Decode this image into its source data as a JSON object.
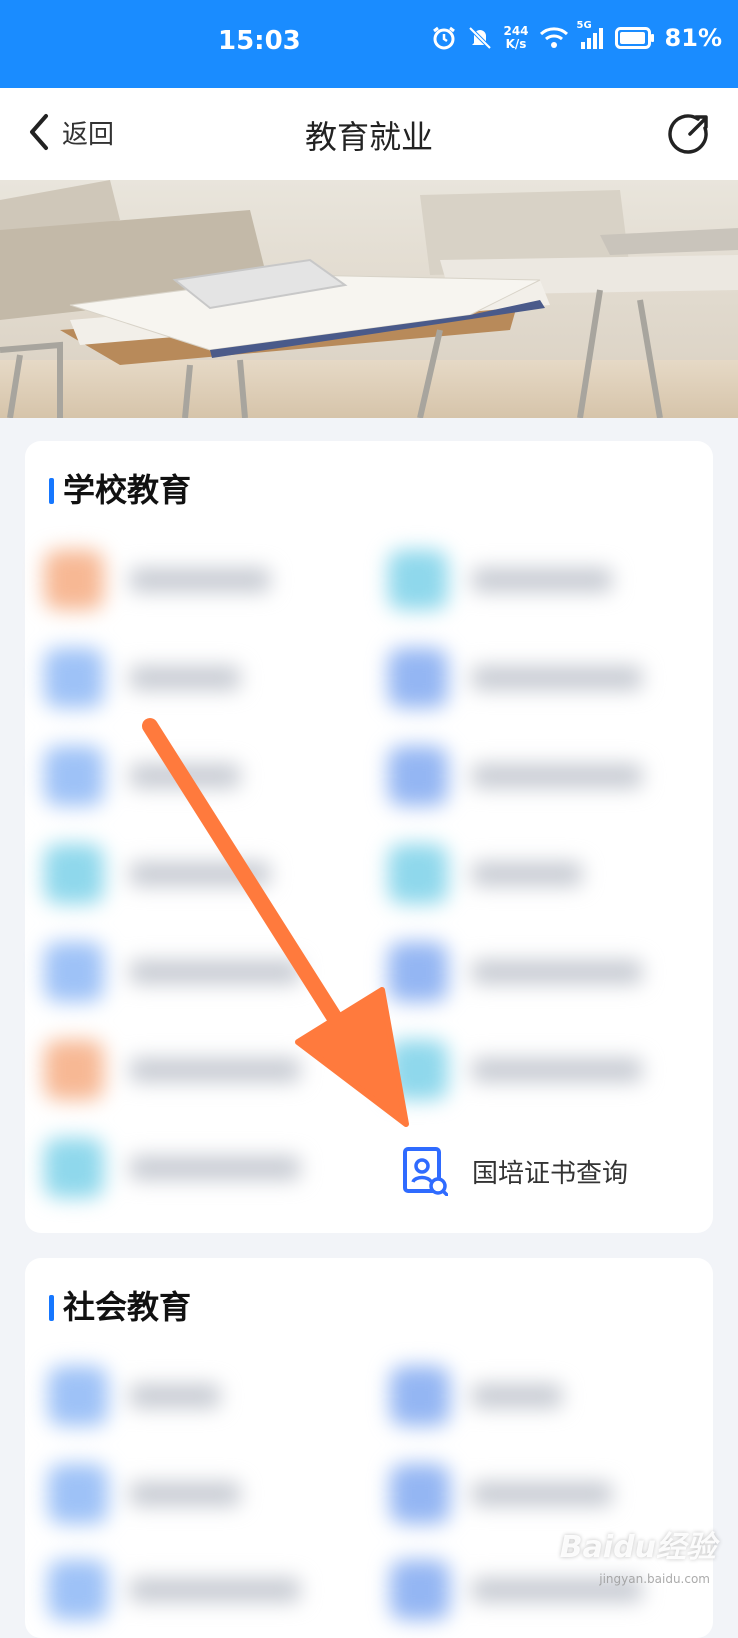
{
  "status_bar": {
    "time": "15:03",
    "speed_top": "244",
    "speed_bottom": "K/s",
    "network": "5G",
    "battery": "81%"
  },
  "header": {
    "back_label": "返回",
    "title": "教育就业"
  },
  "sections": {
    "school": {
      "title": "学校教育",
      "highlight_item": {
        "label": "国培证书查询",
        "icon": "certificate-search-icon"
      }
    },
    "social": {
      "title": "社会教育"
    }
  },
  "watermark": {
    "brand": "Baidu经验",
    "sub": "jingyan.baidu.com"
  },
  "colors": {
    "status_bar": "#1a8cff",
    "accent": "#1677ff",
    "arrow": "#ff7a3d",
    "page_bg": "#f2f4f8"
  }
}
